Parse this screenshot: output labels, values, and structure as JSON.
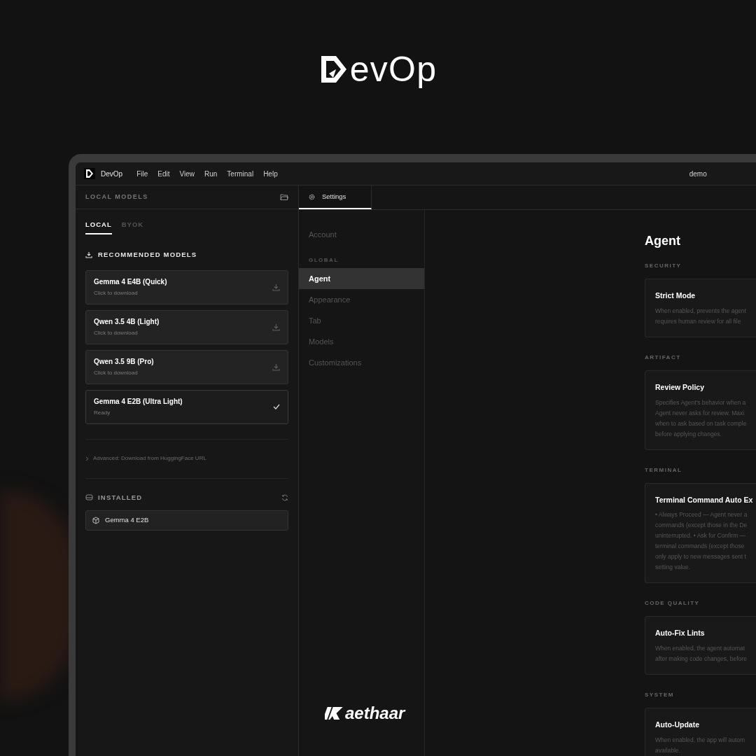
{
  "hero_logo": {
    "text": "evOp"
  },
  "menu_bar": {
    "app_name": "DevOp",
    "menus": [
      "File",
      "Edit",
      "View",
      "Run",
      "Terminal",
      "Help"
    ],
    "workspace": "demo"
  },
  "left_panel": {
    "title": "LOCAL MODELS",
    "tabs": [
      {
        "label": "LOCAL",
        "selected": true
      },
      {
        "label": "BYOK",
        "selected": false
      }
    ],
    "recommended": {
      "title": "RECOMMENDED MODELS",
      "models": [
        {
          "name": "Gemma 4 E4B (Quick)",
          "status": "Click to download",
          "installed": false
        },
        {
          "name": "Qwen 3.5 4B (Light)",
          "status": "Click to download",
          "installed": false
        },
        {
          "name": "Qwen 3.5 9B (Pro)",
          "status": "Click to download",
          "installed": false
        },
        {
          "name": "Gemma 4 E2B (Ultra Light)",
          "status": "Ready",
          "installed": true
        }
      ]
    },
    "advanced": "Advanced: Download from HuggingFace URL",
    "installed": {
      "title": "INSTALLED",
      "items": [
        "Gemma 4 E2B"
      ]
    }
  },
  "editor_tabs": [
    {
      "label": "Settings",
      "selected": true
    }
  ],
  "settings_nav": [
    {
      "kind": "item",
      "label": "Account",
      "selected": false
    },
    {
      "kind": "heading",
      "label": "GLOBAL"
    },
    {
      "kind": "item",
      "label": "Agent",
      "selected": true
    },
    {
      "kind": "item",
      "label": "Appearance",
      "selected": false
    },
    {
      "kind": "item",
      "label": "Tab",
      "selected": false
    },
    {
      "kind": "item",
      "label": "Models",
      "selected": false
    },
    {
      "kind": "item",
      "label": "Customizations",
      "selected": false
    }
  ],
  "content": {
    "title": "Agent",
    "sections": [
      {
        "heading": "SECURITY",
        "title": "Strict Mode",
        "lines": [
          "When enabled, prevents the agent",
          "requires human review for all file"
        ]
      },
      {
        "heading": "ARTIFACT",
        "title": "Review Policy",
        "lines": [
          "Specifies Agent's behavior when a",
          "Agent never asks for review. Maxi",
          "when to ask based on task comple",
          "before applying changes."
        ]
      },
      {
        "heading": "TERMINAL",
        "title": "Terminal Command Auto Ex",
        "lines": [
          "• Always Proceed — Agent never a",
          "commands (except those in the De",
          "uninterrupted. • Ask for Confirm —",
          "terminal commands (except those",
          "only apply to new messages sent t",
          "setting value."
        ]
      },
      {
        "heading": "CODE QUALITY",
        "title": "Auto-Fix Lints",
        "lines": [
          "When enabled, the agent automat",
          "after making code changes, before"
        ]
      },
      {
        "heading": "SYSTEM",
        "title": "Auto-Update",
        "lines": [
          "When enabled, the app will autom",
          "available."
        ]
      }
    ]
  },
  "brand": {
    "text": "aethaar"
  }
}
